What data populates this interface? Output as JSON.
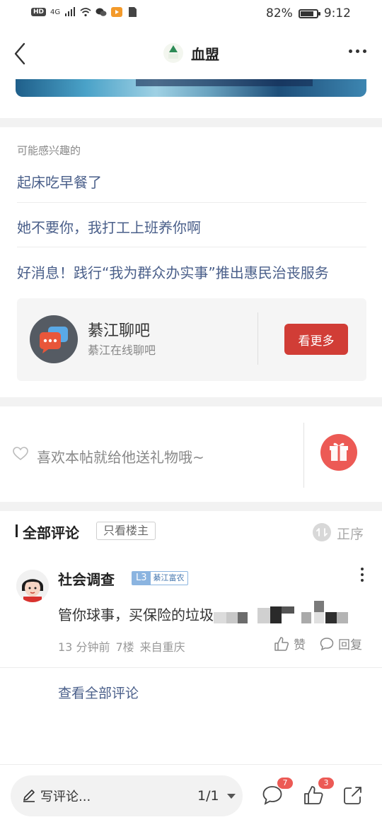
{
  "status_bar": {
    "hd": "HD",
    "network": "4G",
    "battery_percent": "82%",
    "battery_level": 0.82,
    "time": "9:12"
  },
  "header": {
    "title": "血盟",
    "logo_text": "血盟"
  },
  "interest": {
    "label": "可能感兴趣的",
    "items": [
      "起床吃早餐了",
      "她不要你，我打工上班养你啊",
      "好消息！践行“我为群众办实事”推出惠民治丧服务"
    ]
  },
  "group": {
    "name": "綦江聊吧",
    "subtitle": "綦江在线聊吧",
    "button": "看更多"
  },
  "gift": {
    "prompt": "喜欢本帖就给他送礼物哦~"
  },
  "comments": {
    "title": "全部评论",
    "only_op": "只看楼主",
    "sort": "正序",
    "items": [
      {
        "user": "社会调查",
        "level": "L3",
        "level_title": "綦江富农",
        "text": "管你球事，买保险的垃圾",
        "time": "13 分钟前",
        "floor": "7楼",
        "location": "来自重庆",
        "like": "赞",
        "reply": "回复"
      }
    ],
    "view_all": "查看全部评论"
  },
  "bottom_bar": {
    "write_placeholder": "写评论...",
    "pager": "1/1",
    "comment_badge": "7",
    "like_badge": "3"
  },
  "colors": {
    "link": "#4a5f8a",
    "accent_red": "#d13d36",
    "badge_red": "#ec5a55"
  }
}
